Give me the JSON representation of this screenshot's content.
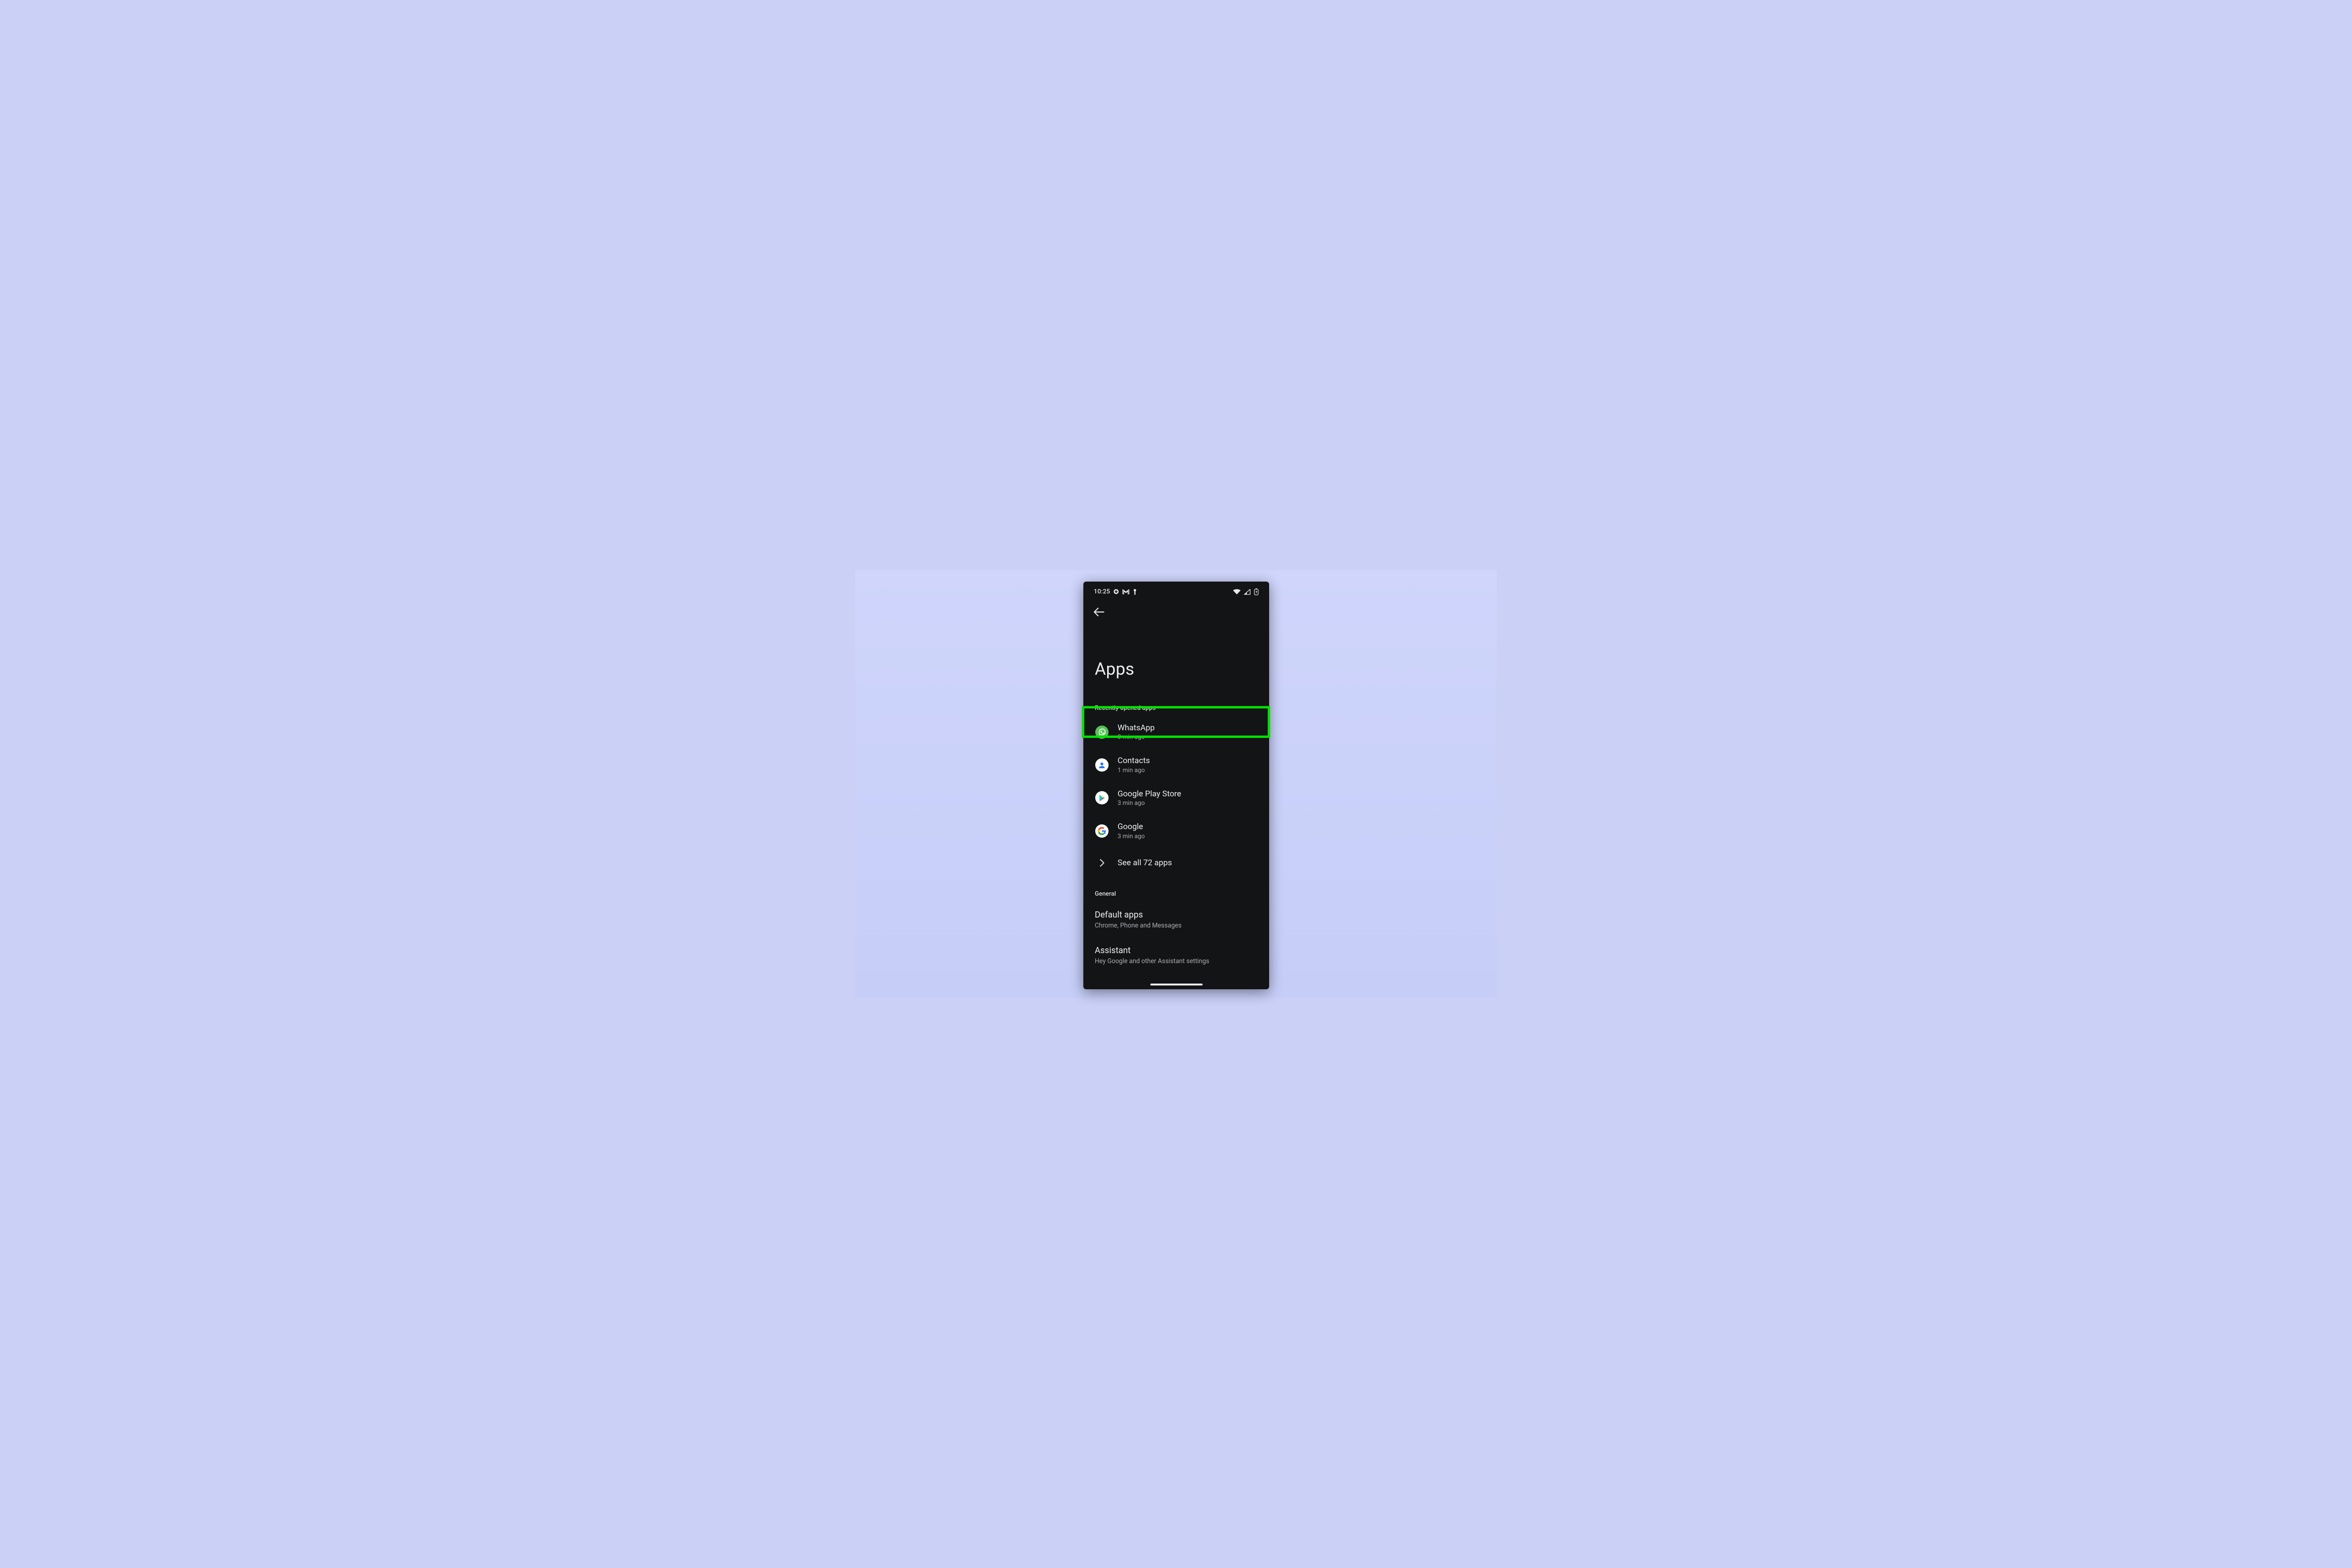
{
  "statusbar": {
    "time": "10:25"
  },
  "page": {
    "title": "Apps"
  },
  "sections": {
    "recent_label": "Recently opened apps",
    "general_label": "General"
  },
  "recent_apps": [
    {
      "name": "WhatsApp",
      "sub": "0 min ago"
    },
    {
      "name": "Contacts",
      "sub": "1 min ago"
    },
    {
      "name": "Google Play Store",
      "sub": "3 min ago"
    },
    {
      "name": "Google",
      "sub": "3 min ago"
    }
  ],
  "see_all": {
    "label": "See all 72 apps"
  },
  "general": [
    {
      "title": "Default apps",
      "sub": "Chrome, Phone and Messages"
    },
    {
      "title": "Assistant",
      "sub": "Hey Google and other Assistant settings"
    }
  ],
  "highlight": {
    "index": 0
  }
}
